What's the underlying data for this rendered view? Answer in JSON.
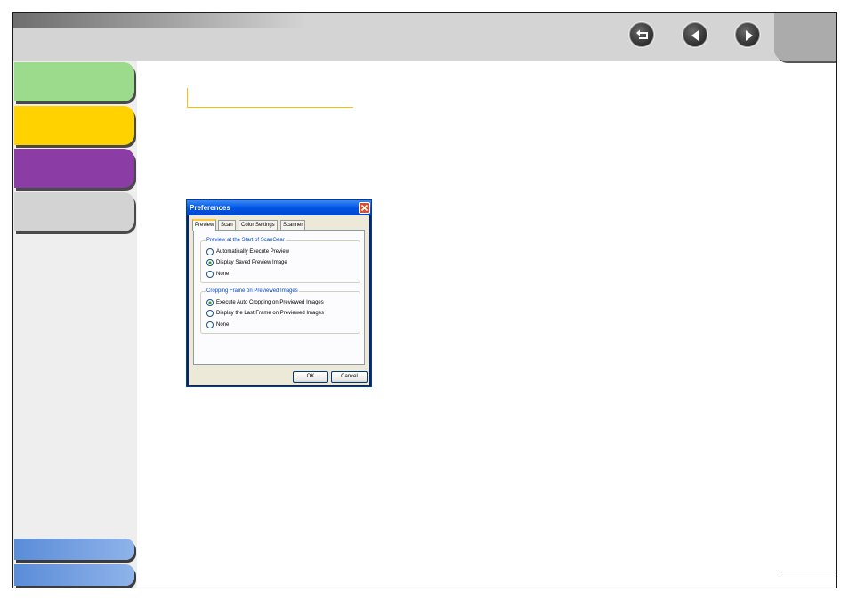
{
  "toolbar": {
    "buttons": [
      {
        "name": "back-button",
        "icon": "return-arrow-icon"
      },
      {
        "name": "previous-page-button",
        "icon": "left-triangle-icon"
      },
      {
        "name": "next-page-button",
        "icon": "right-triangle-icon"
      }
    ]
  },
  "sidebar": {
    "tab_colors": [
      "#9bdb8b",
      "#ffd200",
      "#8c3ca5",
      "#d3d3d3"
    ],
    "bottom_tab_color": "#6f9ee0"
  },
  "dialog": {
    "title": "Preferences",
    "tabs": [
      {
        "label": "Preview",
        "active": true
      },
      {
        "label": "Scan",
        "active": false
      },
      {
        "label": "Color Settings",
        "active": false
      },
      {
        "label": "Scanner",
        "active": false
      }
    ],
    "groups": [
      {
        "legend": "Preview at the Start of ScanGear",
        "options": [
          {
            "label": "Automatically Execute Preview",
            "selected": false
          },
          {
            "label": "Display Saved Preview Image",
            "selected": true
          },
          {
            "label": "None",
            "selected": false
          }
        ]
      },
      {
        "legend": "Cropping Frame on Previewed Images",
        "options": [
          {
            "label": "Execute Auto Cropping on Previewed Images",
            "selected": true
          },
          {
            "label": "Display the Last Frame on Previewed Images",
            "selected": false
          },
          {
            "label": "None",
            "selected": false
          }
        ]
      }
    ],
    "ok_label": "OK",
    "cancel_label": "Cancel"
  },
  "colors": {
    "accent_heading_line": "#f2c400",
    "titlebar_blue": "#0055e5",
    "group_legend_blue": "#0046d5"
  }
}
